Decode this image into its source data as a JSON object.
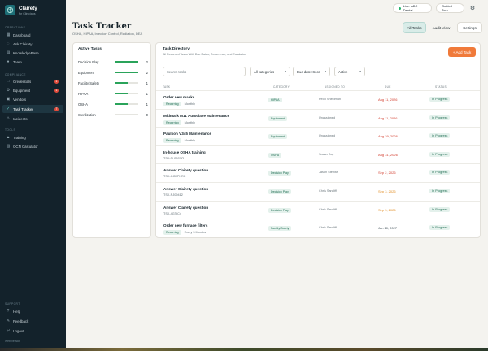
{
  "sidebar": {
    "brand": {
      "name": "Clairety",
      "subtitle": "for Clinicians"
    },
    "sections": [
      {
        "label": "OPERATIONS",
        "items": [
          {
            "label": "Dashboard",
            "icon": "dashboard-icon"
          },
          {
            "label": "Ask Clairety",
            "icon": "chat-icon"
          },
          {
            "label": "KnowledgeBase",
            "icon": "book-icon"
          },
          {
            "label": "Team",
            "icon": "team-icon"
          }
        ]
      },
      {
        "label": "COMPLIANCE",
        "items": [
          {
            "label": "Credentials",
            "icon": "badge-icon",
            "badge": "1"
          },
          {
            "label": "Equipment",
            "icon": "tool-icon",
            "badge": "1"
          },
          {
            "label": "Vendors",
            "icon": "store-icon"
          },
          {
            "label": "Task Tracker",
            "icon": "check-icon",
            "badge": "7",
            "active": true
          },
          {
            "label": "Incidents",
            "icon": "alert-icon"
          }
        ]
      },
      {
        "label": "TOOLS",
        "items": [
          {
            "label": "Training",
            "icon": "training-icon"
          },
          {
            "label": "OCN Calculator",
            "icon": "calculator-icon"
          }
        ]
      },
      {
        "label": "SUPPORT",
        "items": [
          {
            "label": "Help",
            "icon": "help-icon"
          },
          {
            "label": "Feedback",
            "icon": "feedback-icon"
          },
          {
            "label": "Logout",
            "icon": "logout-icon"
          }
        ]
      }
    ],
    "version": "Web Version"
  },
  "topbar": {
    "live_label": "Live: ABC Dental",
    "guided_tour": "Guided Tour",
    "settings_icon": "gear-icon"
  },
  "header": {
    "title": "Task Tracker",
    "subtitle": "OSHA, HIPAA, Infection Control, Radiation, DEA",
    "views": [
      "All Tasks",
      "Audit View",
      "Settings"
    ],
    "active_view": "All Tasks"
  },
  "active_tasks": {
    "title": "Active Tasks",
    "rows": [
      {
        "label": "Decision Play",
        "count": "2",
        "fill": 1.0
      },
      {
        "label": "Equipment",
        "count": "2",
        "fill": 1.0
      },
      {
        "label": "Facility/Safety",
        "count": "1",
        "fill": 0.55
      },
      {
        "label": "HIPAA",
        "count": "1",
        "fill": 0.55
      },
      {
        "label": "OSHA",
        "count": "1",
        "fill": 0.55
      },
      {
        "label": "Sterilization",
        "count": "0",
        "fill": 0.0
      }
    ]
  },
  "directory": {
    "title": "Task Directory",
    "subtitle": "All Recorded Tasks With Due Dates, Recurrence, and Escalation",
    "add_button": "+ Add Task",
    "search_placeholder": "Search tasks",
    "filters": [
      "All categories",
      "Due date: Soon",
      "Active"
    ],
    "columns": [
      "TASK",
      "CATEGORY",
      "ASSIGNED TO",
      "DUE",
      "STATUS"
    ],
    "rows": [
      {
        "name": "Order new masks",
        "chip": "Recurring",
        "meta": "Monthly",
        "category": "HIPAA",
        "assigned": "Peon Sheldman",
        "due": "Aug 11, 2026",
        "due_color": "#d23c2c",
        "status": "In Progress"
      },
      {
        "name": "Midmark M11 Autoclave Maintenance",
        "chip": "Recurring",
        "meta": "Monthly",
        "category": "Equipment",
        "assigned": "Unassigned",
        "due": "Aug 11, 2026",
        "due_color": "#d23c2c",
        "status": "In Progress"
      },
      {
        "name": "Paulson V345 Maintenance",
        "chip": "Recurring",
        "meta": "Monthly",
        "category": "Equipment",
        "assigned": "Unassigned",
        "due": "Aug 29, 2026",
        "due_color": "#d23c2c",
        "status": "In Progress"
      },
      {
        "name": "In-house OSHA training",
        "chip": "",
        "meta": "TSK-PHMCSR",
        "category": "OSHA",
        "assigned": "Susan Day",
        "due": "Aug 31, 2026",
        "due_color": "#d23c2c",
        "status": "In Progress"
      },
      {
        "name": "Answer Clairety question",
        "chip": "",
        "meta": "TSK-OCKPKRC",
        "category": "Decision Play",
        "assigned": "Jason Stewart",
        "due": "Sep 2, 2026",
        "due_color": "#d23c2c",
        "status": "In Progress"
      },
      {
        "name": "Answer Clairety question",
        "chip": "",
        "meta": "TSK-RJ09412",
        "category": "Decision Play",
        "assigned": "Chris Sandiff",
        "due": "Sep 3, 2026",
        "due_color": "#e08a1e",
        "status": "In Progress"
      },
      {
        "name": "Answer Clairety question",
        "chip": "",
        "meta": "TSK-4GTIC4",
        "category": "Decision Play",
        "assigned": "Chris Sandiff",
        "due": "Sep 3, 2026",
        "due_color": "#e08a1e",
        "status": "In Progress"
      },
      {
        "name": "Order new furnace filters",
        "chip": "Recurring",
        "meta": "Every 3 Months",
        "category": "Facility/Safety",
        "assigned": "Chris Sandiff",
        "due": "Jan 10, 2027",
        "due_color": "#3a4a52",
        "status": "In Progress"
      }
    ]
  }
}
